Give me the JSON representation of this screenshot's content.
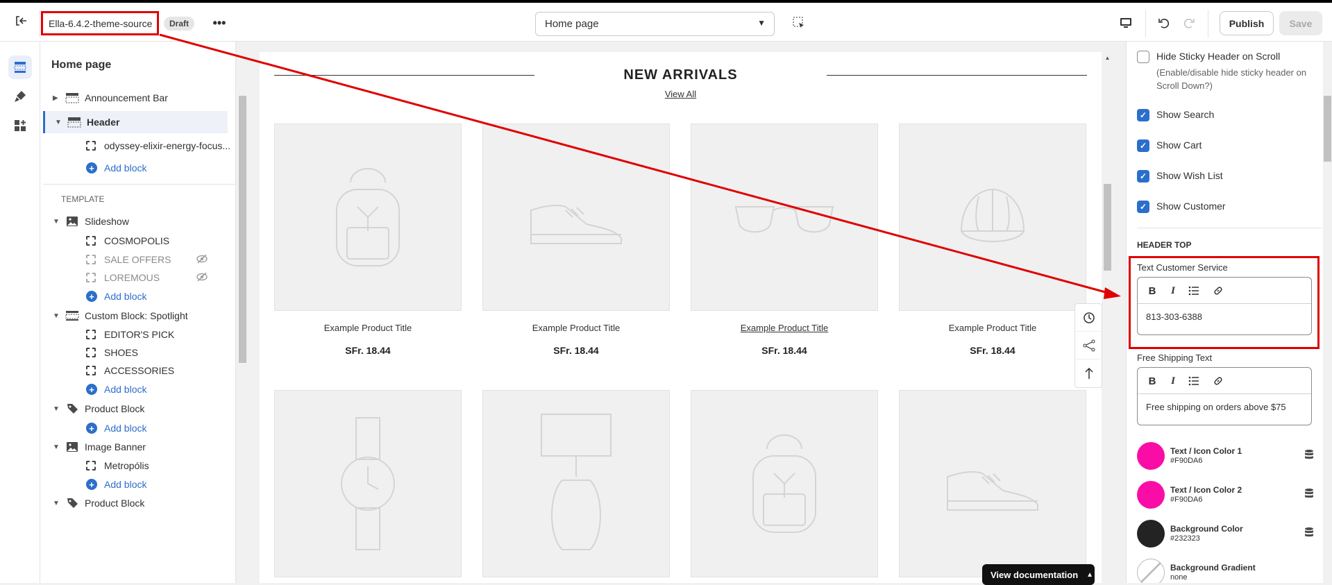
{
  "topbar": {
    "theme_name": "Ella-6.4.2-theme-source",
    "status_badge": "Draft",
    "page_selector_value": "Home page",
    "publish_label": "Publish",
    "save_label": "Save"
  },
  "sidebar": {
    "title": "Home page",
    "header_group": [
      {
        "type": "section",
        "label": "Announcement Bar",
        "icon": "announcement-bar-icon",
        "expanded": false
      },
      {
        "type": "section",
        "label": "Header",
        "icon": "header-icon",
        "expanded": true,
        "selected": true
      },
      {
        "type": "block",
        "label": "odyssey-elixir-energy-focus..."
      },
      {
        "type": "add",
        "label": "Add block"
      }
    ],
    "template_label": "TEMPLATE",
    "template_group": [
      {
        "type": "section",
        "label": "Slideshow",
        "icon": "image-icon",
        "expanded": true
      },
      {
        "type": "block",
        "label": "COSMOPOLIS"
      },
      {
        "type": "block",
        "label": "SALE OFFERS",
        "hidden": true
      },
      {
        "type": "block",
        "label": "LOREMOUS",
        "hidden": true
      },
      {
        "type": "add",
        "label": "Add block"
      },
      {
        "type": "section",
        "label": "Custom Block: Spotlight",
        "icon": "custom-block-icon",
        "expanded": true
      },
      {
        "type": "block",
        "label": "EDITOR'S PICK"
      },
      {
        "type": "block",
        "label": "SHOES"
      },
      {
        "type": "block",
        "label": "ACCESSORIES"
      },
      {
        "type": "add",
        "label": "Add block"
      },
      {
        "type": "section",
        "label": "Product Block",
        "icon": "tag-icon",
        "expanded": true
      },
      {
        "type": "add",
        "label": "Add block"
      },
      {
        "type": "section",
        "label": "Image Banner",
        "icon": "image-icon",
        "expanded": true
      },
      {
        "type": "block",
        "label": "Metropólis"
      },
      {
        "type": "add",
        "label": "Add block"
      },
      {
        "type": "section",
        "label": "Product Block",
        "icon": "tag-icon",
        "expanded": true
      }
    ]
  },
  "preview": {
    "heading": "NEW ARRIVALS",
    "view_all": "View All",
    "products_row1": [
      {
        "title": "Example Product Title",
        "price": "SFr. 18.44",
        "icon": "backpack-icon"
      },
      {
        "title": "Example Product Title",
        "price": "SFr. 18.44",
        "icon": "sneaker-icon"
      },
      {
        "title": "Example Product Title",
        "price": "SFr. 18.44",
        "icon": "sunglasses-icon",
        "hovered": true
      },
      {
        "title": "Example Product Title",
        "price": "SFr. 18.44",
        "icon": "cap-icon"
      }
    ],
    "products_row2": [
      {
        "icon": "watch-icon"
      },
      {
        "icon": "lamp-icon"
      },
      {
        "icon": "backpack-icon"
      },
      {
        "icon": "sneaker-icon"
      }
    ],
    "view_documentation": "View documentation"
  },
  "settings": {
    "hide_sticky": {
      "label": "Hide Sticky Header on Scroll",
      "checked": false,
      "help": "(Enable/disable hide sticky header on Scroll Down?)"
    },
    "checkboxes": [
      {
        "label": "Show Search",
        "checked": true
      },
      {
        "label": "Show Cart",
        "checked": true
      },
      {
        "label": "Show Wish List",
        "checked": true
      },
      {
        "label": "Show Customer",
        "checked": true
      }
    ],
    "section_header_top": "HEADER TOP",
    "text_customer_service": {
      "label": "Text Customer Service",
      "value": "813-303-6388"
    },
    "free_shipping": {
      "label": "Free Shipping Text",
      "value": "Free shipping on orders above $75"
    },
    "colors": [
      {
        "name": "Text / Icon Color 1",
        "value": "#F90DA6"
      },
      {
        "name": "Text / Icon Color 2",
        "value": "#F90DA6"
      },
      {
        "name": "Background Color",
        "value": "#232323"
      },
      {
        "name": "Background Gradient",
        "value": "none"
      }
    ]
  },
  "annotation_color": "#E00000"
}
